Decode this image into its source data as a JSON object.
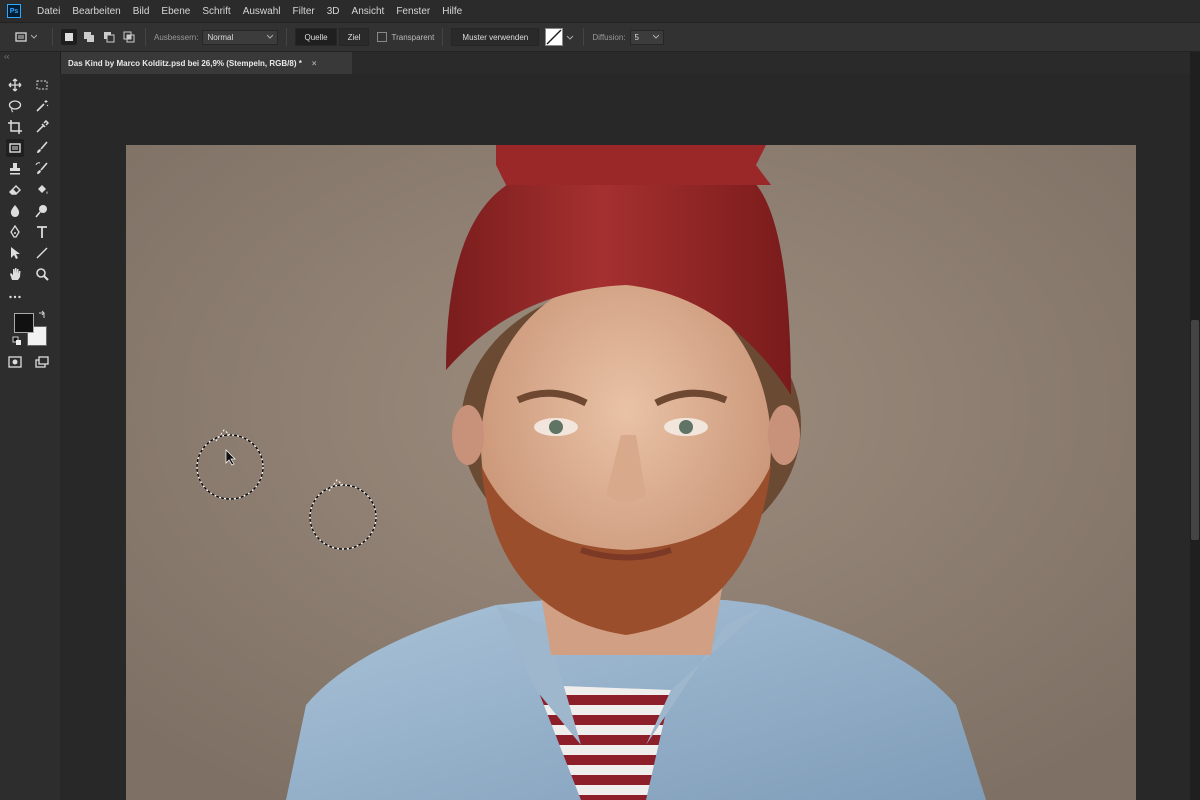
{
  "app": {
    "logo": "Ps"
  },
  "menu": {
    "items": [
      "Datei",
      "Bearbeiten",
      "Bild",
      "Ebene",
      "Schrift",
      "Auswahl",
      "Filter",
      "3D",
      "Ansicht",
      "Fenster",
      "Hilfe"
    ]
  },
  "options": {
    "patch_label": "Ausbessern:",
    "patch_mode": "Normal",
    "source_label": "Quelle",
    "target_label": "Ziel",
    "transparent_label": "Transparent",
    "use_pattern_label": "Muster verwenden",
    "diffusion_label": "Diffusion:",
    "diffusion_value": "5"
  },
  "document": {
    "tab_title": "Das Kind by Marco Kolditz.psd bei 26,9% (Stempeln, RGB/8) *",
    "close": "×"
  },
  "toolbar": {
    "tools": [
      "move-icon",
      "marquee-icon",
      "lasso-icon",
      "magic-wand-icon",
      "crop-icon",
      "eyedropper-icon",
      "patch-icon",
      "brush-icon",
      "stamp-icon",
      "history-brush-icon",
      "eraser-icon",
      "paint-bucket-icon",
      "blur-icon",
      "dodge-icon",
      "pen-icon",
      "type-icon",
      "path-select-icon",
      "line-icon",
      "hand-icon",
      "zoom-icon",
      "more-tools-icon"
    ]
  },
  "colors": {
    "foreground": "#111111",
    "background": "#f2f2f2",
    "accent": "#31a8ff"
  }
}
